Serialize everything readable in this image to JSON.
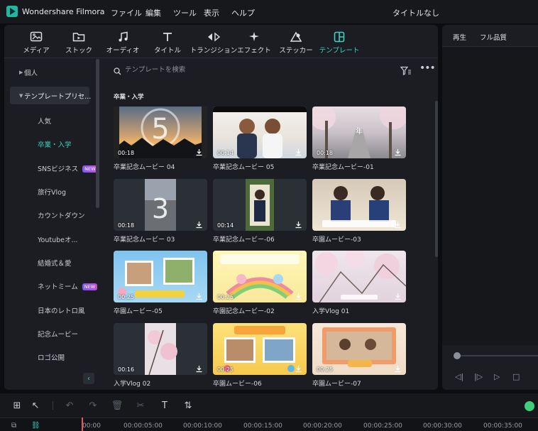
{
  "app": {
    "name": "Wondershare Filmora",
    "doc_title": "タイトルなし"
  },
  "menu": [
    "ファイル",
    "編集",
    "ツール",
    "表示",
    "ヘルプ"
  ],
  "tabs": [
    {
      "label": "メディア",
      "icon": "media-icon"
    },
    {
      "label": "ストック",
      "icon": "stock-folder-icon"
    },
    {
      "label": "オーディオ",
      "icon": "music-note-icon"
    },
    {
      "label": "タイトル",
      "icon": "title-t-icon"
    },
    {
      "label": "トランジション",
      "icon": "transition-arrows-icon"
    },
    {
      "label": "エフェクト",
      "icon": "effect-sparkle-icon"
    },
    {
      "label": "ステッカー",
      "icon": "sticker-icon"
    },
    {
      "label": "テンプレート",
      "icon": "template-icon",
      "active": true
    }
  ],
  "sidebar": {
    "folders": [
      {
        "label": "個人",
        "open": false
      },
      {
        "label": "テンプレートプリセ...",
        "open": true
      }
    ],
    "items": [
      {
        "label": "人気"
      },
      {
        "label": "卒業・入学",
        "active": true
      },
      {
        "label": "SNSビジネス",
        "badge": "NEW"
      },
      {
        "label": "旅行Vlog"
      },
      {
        "label": "カウントダウン"
      },
      {
        "label": "Youtubeオ..."
      },
      {
        "label": "結婚式＆愛"
      },
      {
        "label": "ネットミーム",
        "badge": "NEW"
      },
      {
        "label": "日本のレトロ風"
      },
      {
        "label": "記念ムービー"
      },
      {
        "label": "ロゴ公開"
      }
    ]
  },
  "search": {
    "placeholder": "テンプレートを検索"
  },
  "section_title": "卒業・入学",
  "templates": [
    {
      "title": "卒業記念ムービー 04",
      "duration": "00:18"
    },
    {
      "title": "卒業記念ムービー 05",
      "duration": "00:14"
    },
    {
      "title": "卒業記念ムービー-01",
      "duration": "00:18"
    },
    {
      "title": "卒業記念ムービー 03",
      "duration": "00:18"
    },
    {
      "title": "卒業記念ムービー-06",
      "duration": "00:14"
    },
    {
      "title": "卒園ムービー-03",
      "duration": ""
    },
    {
      "title": "卒園ムービー-05",
      "duration": "00:25"
    },
    {
      "title": "卒園記念ムービー-02",
      "duration": "00:25"
    },
    {
      "title": "入学Vlog 01",
      "duration": ""
    },
    {
      "title": "入学Vlog 02",
      "duration": "00:16"
    },
    {
      "title": "卒園ムービー-06",
      "duration": "00:25"
    },
    {
      "title": "卒園ムービー-07",
      "duration": "00:25"
    }
  ],
  "preview": {
    "tab_play": "再生",
    "tab_quality": "フル品質"
  },
  "timeline": {
    "times": [
      "00:00",
      "00:00:05:00",
      "00:00:10:00",
      "00:00:15:00",
      "00:00:20:00",
      "00:00:25:00",
      "00:00:30:00",
      "00:00:35:00"
    ]
  }
}
